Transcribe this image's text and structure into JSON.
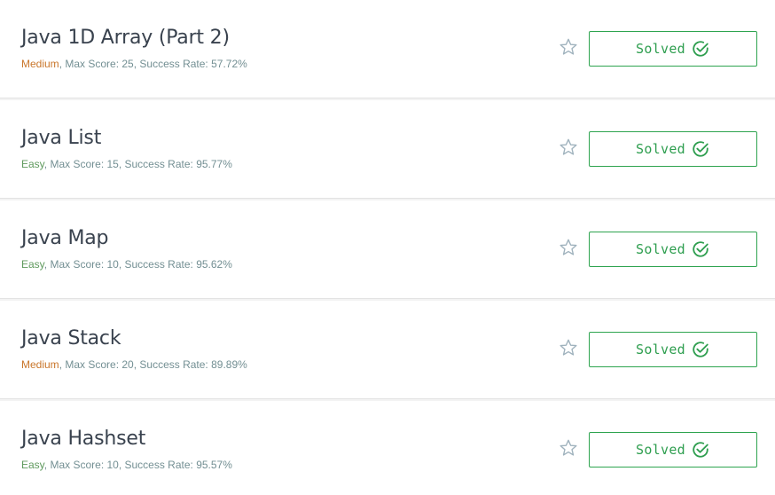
{
  "accent": {
    "solved": "#2e9e4f",
    "medium": "#c9762b",
    "easy": "#5f9a5d",
    "meta": "#738f93",
    "title": "#39424e"
  },
  "challenges": [
    {
      "title": "Java 1D Array (Part 2)",
      "difficulty": "Medium",
      "difficulty_class": "medium",
      "details": ", Max Score: 25, Success Rate: 57.72%",
      "status": "Solved",
      "bookmark_icon": "star-outline-icon",
      "status_icon": "check-circle-icon"
    },
    {
      "title": "Java List",
      "difficulty": "Easy",
      "difficulty_class": "easy",
      "details": ", Max Score: 15, Success Rate: 95.77%",
      "status": "Solved",
      "bookmark_icon": "star-outline-icon",
      "status_icon": "check-circle-icon"
    },
    {
      "title": "Java Map",
      "difficulty": "Easy",
      "difficulty_class": "easy",
      "details": ", Max Score: 10, Success Rate: 95.62%",
      "status": "Solved",
      "bookmark_icon": "star-outline-icon",
      "status_icon": "check-circle-icon"
    },
    {
      "title": "Java Stack",
      "difficulty": "Medium",
      "difficulty_class": "medium",
      "details": ", Max Score: 20, Success Rate: 89.89%",
      "status": "Solved",
      "bookmark_icon": "star-outline-icon",
      "status_icon": "check-circle-icon"
    },
    {
      "title": "Java Hashset",
      "difficulty": "Easy",
      "difficulty_class": "easy",
      "details": ", Max Score: 10, Success Rate: 95.57%",
      "status": "Solved",
      "bookmark_icon": "star-outline-icon",
      "status_icon": "check-circle-icon"
    }
  ]
}
